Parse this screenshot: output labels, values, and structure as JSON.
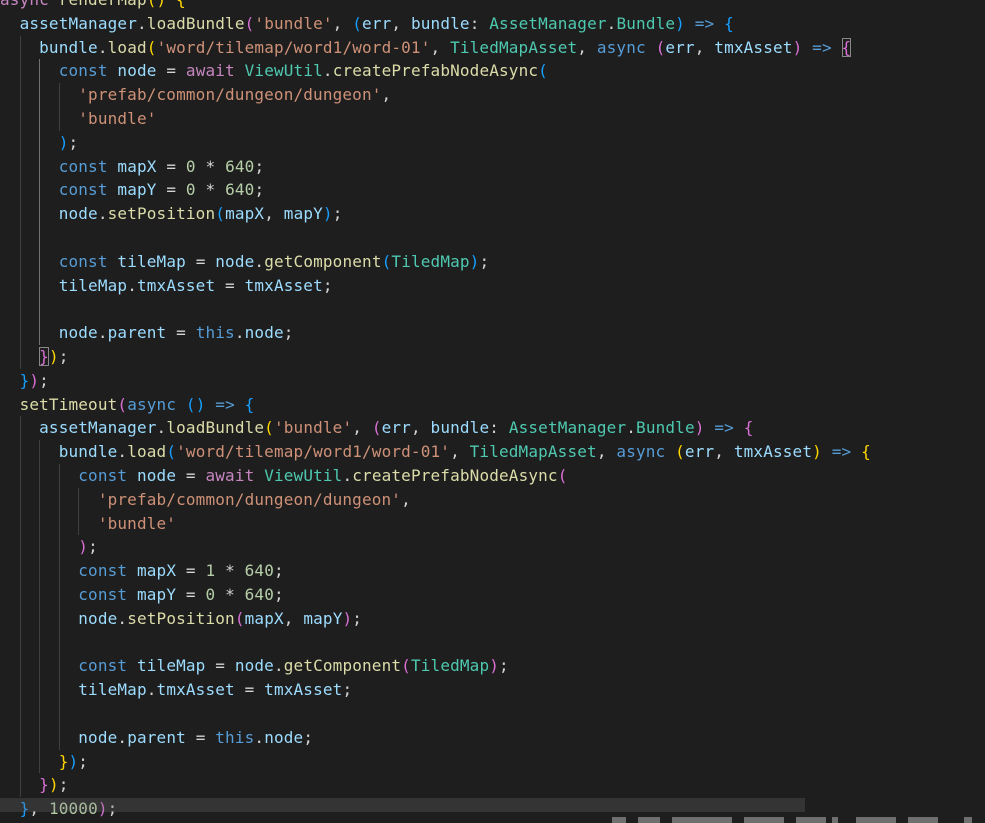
{
  "colors": {
    "background": "#1e1e1e",
    "keyword": "#569cd6",
    "control": "#c586c0",
    "variable": "#9cdcfe",
    "function": "#dcdcaa",
    "string": "#ce9178",
    "number": "#b5cea8",
    "type": "#4ec9b0",
    "punctuation": "#d4d4d4",
    "bracket_level_1": "#ffd700",
    "bracket_level_2": "#da70d6",
    "bracket_level_3": "#179fff"
  },
  "editor": {
    "lines": [
      [
        [
          "ctl",
          "async "
        ],
        [
          "fn",
          "renderMap"
        ],
        [
          "p1",
          "()"
        ],
        [
          "punc",
          " "
        ],
        [
          "p1",
          "{"
        ]
      ],
      [
        [
          "punc",
          "  "
        ],
        [
          "var",
          "assetManager"
        ],
        [
          "punc",
          "."
        ],
        [
          "fn",
          "loadBundle"
        ],
        [
          "p2",
          "("
        ],
        [
          "str",
          "'bundle'"
        ],
        [
          "punc",
          ", "
        ],
        [
          "p3",
          "("
        ],
        [
          "var",
          "err"
        ],
        [
          "punc",
          ", "
        ],
        [
          "var",
          "bundle"
        ],
        [
          "punc",
          ": "
        ],
        [
          "type",
          "AssetManager"
        ],
        [
          "punc",
          "."
        ],
        [
          "type",
          "Bundle"
        ],
        [
          "p3",
          ")"
        ],
        [
          "punc",
          " "
        ],
        [
          "kw",
          "=>"
        ],
        [
          "punc",
          " "
        ],
        [
          "p3",
          "{"
        ]
      ],
      [
        [
          "punc",
          "    "
        ],
        [
          "var",
          "bundle"
        ],
        [
          "punc",
          "."
        ],
        [
          "fn",
          "load"
        ],
        [
          "p1",
          "("
        ],
        [
          "str",
          "'word/tilemap/word1/word-01'"
        ],
        [
          "punc",
          ", "
        ],
        [
          "type",
          "TiledMapAsset"
        ],
        [
          "punc",
          ", "
        ],
        [
          "kw",
          "async"
        ],
        [
          "punc",
          " "
        ],
        [
          "p2",
          "("
        ],
        [
          "var",
          "err"
        ],
        [
          "punc",
          ", "
        ],
        [
          "var",
          "tmxAsset"
        ],
        [
          "p2",
          ")"
        ],
        [
          "punc",
          " "
        ],
        [
          "kw",
          "=>"
        ],
        [
          "punc",
          " "
        ],
        [
          "p2m",
          "{"
        ]
      ],
      [
        [
          "punc",
          "      "
        ],
        [
          "kw",
          "const"
        ],
        [
          "punc",
          " "
        ],
        [
          "var",
          "node"
        ],
        [
          "punc",
          " = "
        ],
        [
          "ctl",
          "await"
        ],
        [
          "punc",
          " "
        ],
        [
          "type",
          "ViewUtil"
        ],
        [
          "punc",
          "."
        ],
        [
          "fn",
          "createPrefabNodeAsync"
        ],
        [
          "p3",
          "("
        ]
      ],
      [
        [
          "punc",
          "        "
        ],
        [
          "str",
          "'prefab/common/dungeon/dungeon'"
        ],
        [
          "punc",
          ","
        ]
      ],
      [
        [
          "punc",
          "        "
        ],
        [
          "str",
          "'bundle'"
        ]
      ],
      [
        [
          "punc",
          "      "
        ],
        [
          "p3",
          ")"
        ],
        [
          "punc",
          ";"
        ]
      ],
      [
        [
          "punc",
          "      "
        ],
        [
          "kw",
          "const"
        ],
        [
          "punc",
          " "
        ],
        [
          "var",
          "mapX"
        ],
        [
          "punc",
          " = "
        ],
        [
          "num",
          "0"
        ],
        [
          "punc",
          " * "
        ],
        [
          "num",
          "640"
        ],
        [
          "punc",
          ";"
        ]
      ],
      [
        [
          "punc",
          "      "
        ],
        [
          "kw",
          "const"
        ],
        [
          "punc",
          " "
        ],
        [
          "var",
          "mapY"
        ],
        [
          "punc",
          " = "
        ],
        [
          "num",
          "0"
        ],
        [
          "punc",
          " * "
        ],
        [
          "num",
          "640"
        ],
        [
          "punc",
          ";"
        ]
      ],
      [
        [
          "punc",
          "      "
        ],
        [
          "var",
          "node"
        ],
        [
          "punc",
          "."
        ],
        [
          "fn",
          "setPosition"
        ],
        [
          "p3",
          "("
        ],
        [
          "var",
          "mapX"
        ],
        [
          "punc",
          ", "
        ],
        [
          "var",
          "mapY"
        ],
        [
          "p3",
          ")"
        ],
        [
          "punc",
          ";"
        ]
      ],
      [],
      [
        [
          "punc",
          "      "
        ],
        [
          "kw",
          "const"
        ],
        [
          "punc",
          " "
        ],
        [
          "var",
          "tileMap"
        ],
        [
          "punc",
          " = "
        ],
        [
          "var",
          "node"
        ],
        [
          "punc",
          "."
        ],
        [
          "fn",
          "getComponent"
        ],
        [
          "p3",
          "("
        ],
        [
          "type",
          "TiledMap"
        ],
        [
          "p3",
          ")"
        ],
        [
          "punc",
          ";"
        ]
      ],
      [
        [
          "punc",
          "      "
        ],
        [
          "var",
          "tileMap"
        ],
        [
          "punc",
          "."
        ],
        [
          "var",
          "tmxAsset"
        ],
        [
          "punc",
          " = "
        ],
        [
          "var",
          "tmxAsset"
        ],
        [
          "punc",
          ";"
        ]
      ],
      [],
      [
        [
          "punc",
          "      "
        ],
        [
          "var",
          "node"
        ],
        [
          "punc",
          "."
        ],
        [
          "var",
          "parent"
        ],
        [
          "punc",
          " = "
        ],
        [
          "kw",
          "this"
        ],
        [
          "punc",
          "."
        ],
        [
          "var",
          "node"
        ],
        [
          "punc",
          ";"
        ]
      ],
      [
        [
          "punc",
          "    "
        ],
        [
          "p2m",
          "}"
        ],
        [
          "p1",
          ")"
        ],
        [
          "punc",
          ";"
        ]
      ],
      [
        [
          "punc",
          "  "
        ],
        [
          "p3",
          "}"
        ],
        [
          "p2",
          ")"
        ],
        [
          "punc",
          ";"
        ]
      ],
      [
        [
          "punc",
          "  "
        ],
        [
          "fn",
          "setTimeout"
        ],
        [
          "p2",
          "("
        ],
        [
          "kw",
          "async"
        ],
        [
          "punc",
          " "
        ],
        [
          "p3",
          "()"
        ],
        [
          "punc",
          " "
        ],
        [
          "kw",
          "=>"
        ],
        [
          "punc",
          " "
        ],
        [
          "p3",
          "{"
        ]
      ],
      [
        [
          "punc",
          "    "
        ],
        [
          "var",
          "assetManager"
        ],
        [
          "punc",
          "."
        ],
        [
          "fn",
          "loadBundle"
        ],
        [
          "p1",
          "("
        ],
        [
          "str",
          "'bundle'"
        ],
        [
          "punc",
          ", "
        ],
        [
          "p2",
          "("
        ],
        [
          "var",
          "err"
        ],
        [
          "punc",
          ", "
        ],
        [
          "var",
          "bundle"
        ],
        [
          "punc",
          ": "
        ],
        [
          "type",
          "AssetManager"
        ],
        [
          "punc",
          "."
        ],
        [
          "type",
          "Bundle"
        ],
        [
          "p2",
          ")"
        ],
        [
          "punc",
          " "
        ],
        [
          "kw",
          "=>"
        ],
        [
          "punc",
          " "
        ],
        [
          "p2",
          "{"
        ]
      ],
      [
        [
          "punc",
          "      "
        ],
        [
          "var",
          "bundle"
        ],
        [
          "punc",
          "."
        ],
        [
          "fn",
          "load"
        ],
        [
          "p3",
          "("
        ],
        [
          "str",
          "'word/tilemap/word1/word-01'"
        ],
        [
          "punc",
          ", "
        ],
        [
          "type",
          "TiledMapAsset"
        ],
        [
          "punc",
          ", "
        ],
        [
          "kw",
          "async"
        ],
        [
          "punc",
          " "
        ],
        [
          "p1",
          "("
        ],
        [
          "var",
          "err"
        ],
        [
          "punc",
          ", "
        ],
        [
          "var",
          "tmxAsset"
        ],
        [
          "p1",
          ")"
        ],
        [
          "punc",
          " "
        ],
        [
          "kw",
          "=>"
        ],
        [
          "punc",
          " "
        ],
        [
          "p1",
          "{"
        ]
      ],
      [
        [
          "punc",
          "        "
        ],
        [
          "kw",
          "const"
        ],
        [
          "punc",
          " "
        ],
        [
          "var",
          "node"
        ],
        [
          "punc",
          " = "
        ],
        [
          "ctl",
          "await"
        ],
        [
          "punc",
          " "
        ],
        [
          "type",
          "ViewUtil"
        ],
        [
          "punc",
          "."
        ],
        [
          "fn",
          "createPrefabNodeAsync"
        ],
        [
          "p2",
          "("
        ]
      ],
      [
        [
          "punc",
          "          "
        ],
        [
          "str",
          "'prefab/common/dungeon/dungeon'"
        ],
        [
          "punc",
          ","
        ]
      ],
      [
        [
          "punc",
          "          "
        ],
        [
          "str",
          "'bundle'"
        ]
      ],
      [
        [
          "punc",
          "        "
        ],
        [
          "p2",
          ")"
        ],
        [
          "punc",
          ";"
        ]
      ],
      [
        [
          "punc",
          "        "
        ],
        [
          "kw",
          "const"
        ],
        [
          "punc",
          " "
        ],
        [
          "var",
          "mapX"
        ],
        [
          "punc",
          " = "
        ],
        [
          "num",
          "1"
        ],
        [
          "punc",
          " * "
        ],
        [
          "num",
          "640"
        ],
        [
          "punc",
          ";"
        ]
      ],
      [
        [
          "punc",
          "        "
        ],
        [
          "kw",
          "const"
        ],
        [
          "punc",
          " "
        ],
        [
          "var",
          "mapY"
        ],
        [
          "punc",
          " = "
        ],
        [
          "num",
          "0"
        ],
        [
          "punc",
          " * "
        ],
        [
          "num",
          "640"
        ],
        [
          "punc",
          ";"
        ]
      ],
      [
        [
          "punc",
          "        "
        ],
        [
          "var",
          "node"
        ],
        [
          "punc",
          "."
        ],
        [
          "fn",
          "setPosition"
        ],
        [
          "p2",
          "("
        ],
        [
          "var",
          "mapX"
        ],
        [
          "punc",
          ", "
        ],
        [
          "var",
          "mapY"
        ],
        [
          "p2",
          ")"
        ],
        [
          "punc",
          ";"
        ]
      ],
      [],
      [
        [
          "punc",
          "        "
        ],
        [
          "kw",
          "const"
        ],
        [
          "punc",
          " "
        ],
        [
          "var",
          "tileMap"
        ],
        [
          "punc",
          " = "
        ],
        [
          "var",
          "node"
        ],
        [
          "punc",
          "."
        ],
        [
          "fn",
          "getComponent"
        ],
        [
          "p2",
          "("
        ],
        [
          "type",
          "TiledMap"
        ],
        [
          "p2",
          ")"
        ],
        [
          "punc",
          ";"
        ]
      ],
      [
        [
          "punc",
          "        "
        ],
        [
          "var",
          "tileMap"
        ],
        [
          "punc",
          "."
        ],
        [
          "var",
          "tmxAsset"
        ],
        [
          "punc",
          " = "
        ],
        [
          "var",
          "tmxAsset"
        ],
        [
          "punc",
          ";"
        ]
      ],
      [],
      [
        [
          "punc",
          "        "
        ],
        [
          "var",
          "node"
        ],
        [
          "punc",
          "."
        ],
        [
          "var",
          "parent"
        ],
        [
          "punc",
          " = "
        ],
        [
          "kw",
          "this"
        ],
        [
          "punc",
          "."
        ],
        [
          "var",
          "node"
        ],
        [
          "punc",
          ";"
        ]
      ],
      [
        [
          "punc",
          "      "
        ],
        [
          "p1",
          "}"
        ],
        [
          "p3",
          ")"
        ],
        [
          "punc",
          ";"
        ]
      ],
      [
        [
          "punc",
          "    "
        ],
        [
          "p2",
          "}"
        ],
        [
          "p1",
          ")"
        ],
        [
          "punc",
          ";"
        ]
      ],
      [
        [
          "punc",
          "  "
        ],
        [
          "p3",
          "}"
        ],
        [
          "punc",
          ", "
        ],
        [
          "num",
          "10000"
        ],
        [
          "p2",
          ")"
        ],
        [
          "punc",
          ";"
        ]
      ]
    ]
  }
}
